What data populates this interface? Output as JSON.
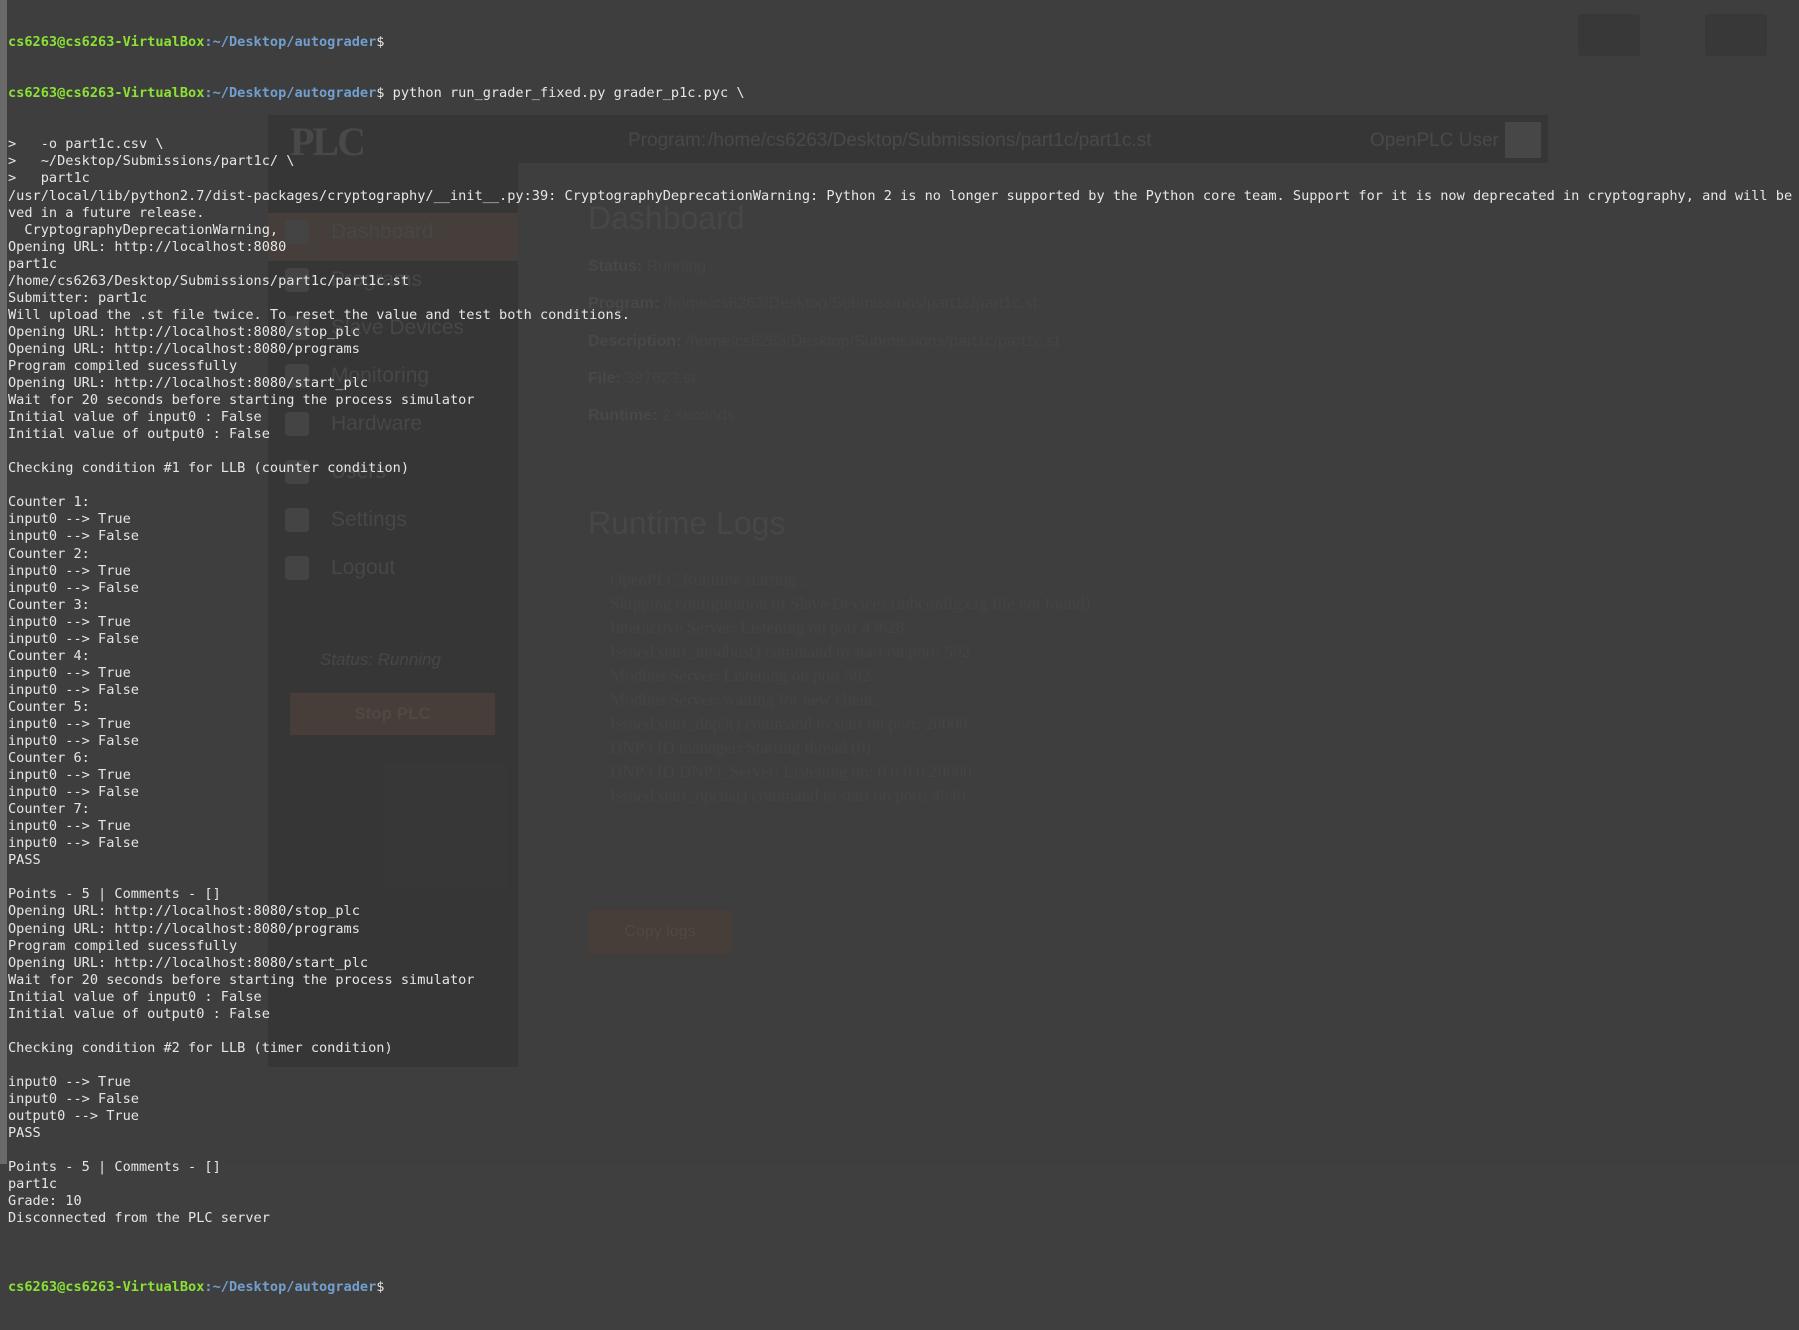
{
  "background_app": {
    "header": {
      "logo_text": "PLC",
      "program_label": "Program:",
      "program_path": "/home/cs6263/Desktop/Submissions/part1c/part1c.st",
      "user_label": "OpenPLC User"
    },
    "sidebar": {
      "items": [
        {
          "label": "Dashboard",
          "icon": "dashboard-icon"
        },
        {
          "label": "Programs",
          "icon": "programs-icon"
        },
        {
          "label": "Slave Devices",
          "icon": "gear-icon"
        },
        {
          "label": "Monitoring",
          "icon": "monitor-icon"
        },
        {
          "label": "Hardware",
          "icon": "chip-icon"
        },
        {
          "label": "Users",
          "icon": "users-icon"
        },
        {
          "label": "Settings",
          "icon": "wrench-icon"
        },
        {
          "label": "Logout",
          "icon": "logout-icon"
        }
      ],
      "status_text": "Status: Running",
      "stop_button": "Stop PLC"
    },
    "dashboard": {
      "title": "Dashboard",
      "status_label": "Status:",
      "status_value": "Running",
      "program_label": "Program:",
      "program_value": "/home/cs6263/Desktop/Submissions/part1c/part1c.st",
      "description_label": "Description:",
      "description_value": "/home/cs6263/Desktop/Submissions/part1c/part1c.st",
      "file_label": "File:",
      "file_value": "397623.st",
      "runtime_label": "Runtime:",
      "runtime_value": "2 seconds"
    },
    "logs": {
      "title": "Runtime Logs",
      "lines": [
        "OpenPLC Runtime starting...",
        "Skipping configuration of Slave Devices (mbconfig.cfg file not found)",
        "Interactive Server: Listening on port 43628",
        "Issued start_modbus() command to start on port: 502",
        "Modbus Server: Listening on port 502",
        "Modbus Server: waiting for new client...",
        "Issued start_dnp3() command to start on port: 20000",
        "DNP3 ID manager: Starting thread (0)",
        "DNP3 ID DNP3_Server: Listening on: 0.0.0.0:20000",
        "Issued start_opcua() command to start on port: 4840"
      ],
      "copy_button": "Copy logs"
    }
  },
  "terminal": {
    "prompt_user": "cs6263@cs6263-VirtualBox",
    "prompt_path": ":~/Desktop/autograder",
    "prompt_dollar": "$",
    "command": " python run_grader_fixed.py grader_p1c.pyc \\",
    "lines": [
      ">   -o part1c.csv \\",
      ">   ~/Desktop/Submissions/part1c/ \\",
      ">   part1c",
      "/usr/local/lib/python2.7/dist-packages/cryptography/__init__.py:39: CryptographyDeprecationWarning: Python 2 is no longer supported by the Python core team. Support for it is now deprecated in cryptography, and will be remo",
      "ved in a future release.",
      "  CryptographyDeprecationWarning,",
      "Opening URL: http://localhost:8080",
      "part1c",
      "/home/cs6263/Desktop/Submissions/part1c/part1c.st",
      "Submitter: part1c",
      "Will upload the .st file twice. To reset the value and test both conditions.",
      "Opening URL: http://localhost:8080/stop_plc",
      "Opening URL: http://localhost:8080/programs",
      "Program compiled sucessfully",
      "Opening URL: http://localhost:8080/start_plc",
      "Wait for 20 seconds before starting the process simulator",
      "Initial value of input0 : False",
      "Initial value of output0 : False",
      "",
      "Checking condition #1 for LLB (counter condition)",
      "",
      "Counter 1:",
      "input0 --> True",
      "input0 --> False",
      "Counter 2:",
      "input0 --> True",
      "input0 --> False",
      "Counter 3:",
      "input0 --> True",
      "input0 --> False",
      "Counter 4:",
      "input0 --> True",
      "input0 --> False",
      "Counter 5:",
      "input0 --> True",
      "input0 --> False",
      "Counter 6:",
      "input0 --> True",
      "input0 --> False",
      "Counter 7:",
      "input0 --> True",
      "input0 --> False",
      "PASS",
      "",
      "Points - 5 | Comments - []",
      "Opening URL: http://localhost:8080/stop_plc",
      "Opening URL: http://localhost:8080/programs",
      "Program compiled sucessfully",
      "Opening URL: http://localhost:8080/start_plc",
      "Wait for 20 seconds before starting the process simulator",
      "Initial value of input0 : False",
      "Initial value of output0 : False",
      "",
      "Checking condition #2 for LLB (timer condition)",
      "",
      "input0 --> True",
      "input0 --> False",
      "output0 --> True",
      "PASS",
      "",
      "Points - 5 | Comments - []",
      "part1c",
      "Grade: 10",
      "Disconnected from the PLC server",
      ""
    ]
  },
  "colors": {
    "prompt_user": "#8ae234",
    "prompt_path": "#729fcf",
    "text": "#e6e6e6",
    "accent": "#e2583e"
  }
}
